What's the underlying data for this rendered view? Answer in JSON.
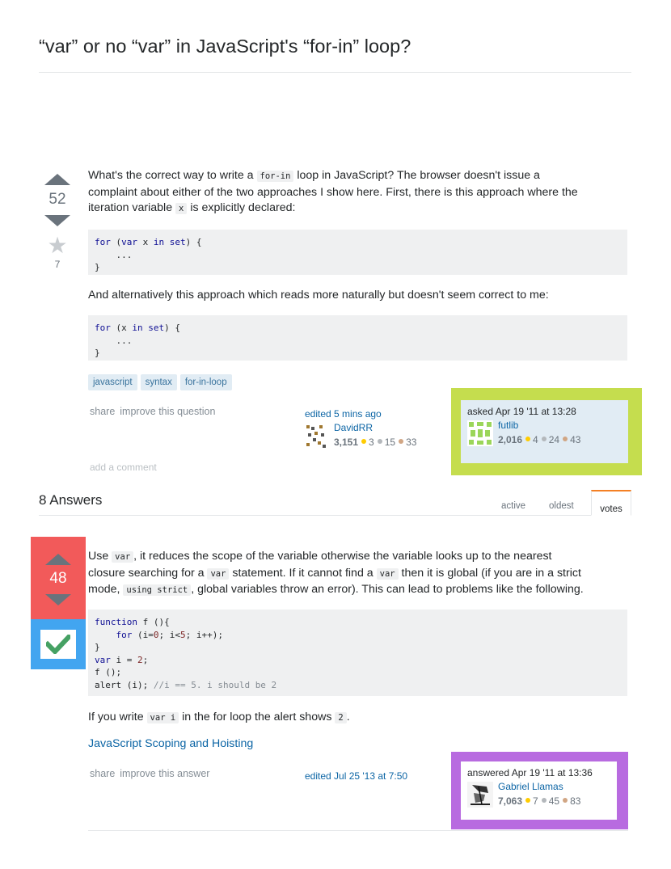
{
  "question": {
    "title": "“var” or no “var” in JavaScript's “for-in” loop?",
    "votes": "52",
    "favorites": "7",
    "p1_a": "What's the correct way to write a ",
    "p1_code": "for-in",
    "p1_b": " loop in JavaScript? The browser doesn't issue a",
    "p1_line2": "complaint about either of the two approaches I show here. First, there is this approach where the",
    "p1_line3a": "iteration variable ",
    "p1_line3code": "x",
    "p1_line3b": " is explicitly declared:",
    "code1": [
      "for (var x in set) {",
      "    ...",
      "}"
    ],
    "p2": "And alternatively this approach which reads more naturally but doesn't seem correct to me:",
    "code2": [
      "for (x in set) {",
      "    ...",
      "}"
    ],
    "tags": [
      "javascript",
      "syntax",
      "for-in-loop"
    ],
    "menu": {
      "share": "share",
      "improve": "improve this question"
    },
    "edited": {
      "label": "edited 5 mins ago",
      "user": "DavidRR",
      "rep": "3,151",
      "gold": "3",
      "silver": "15",
      "bronze": "33"
    },
    "asked": {
      "label": "asked Apr 19 '11 at 13:28",
      "user": "futlib",
      "rep": "2,016",
      "gold": "4",
      "silver": "24",
      "bronze": "43"
    },
    "add_comment": "add a comment"
  },
  "answers_header": {
    "count_label": "8 Answers",
    "tabs": [
      "active",
      "oldest",
      "votes"
    ]
  },
  "answer": {
    "votes": "48",
    "l1a": "Use ",
    "l1code": "var",
    "l1b": ", it reduces the scope of the variable otherwise the variable looks up to the nearest",
    "l2a": "closure searching for a ",
    "l2code": "var",
    "l2b": " statement. If it cannot find a ",
    "l2code2": "var",
    "l2c": " then it is global (if you are in a strict",
    "l3a": "mode, ",
    "l3code": "using strict",
    "l3b": ", global variables throw an error). This can lead to problems like the following.",
    "code": {
      "l1_kw": "function",
      "l1_rest": " f (){",
      "l2_indent": "    ",
      "l2_kw": "for",
      "l2_a": " (i=",
      "l2_n0": "0",
      "l2_b": "; i<",
      "l2_n5": "5",
      "l2_c": "; i++);",
      "l3": "}",
      "l4_kw": "var",
      "l4_a": " i = ",
      "l4_n": "2",
      "l4_b": ";",
      "l5": "f ();",
      "l6_a": "alert (i); ",
      "l6_com": "//i == 5. i should be 2"
    },
    "p2a": "If you write ",
    "p2code": "var i",
    "p2b": " in the for loop the alert shows ",
    "p2code2": "2",
    "p2c": ".",
    "link": "JavaScript Scoping and Hoisting",
    "menu": {
      "share": "share",
      "improve": "improve this answer"
    },
    "edited": {
      "label": "edited Jul 25 '13 at 7:50"
    },
    "answered": {
      "label": "answered Apr 19 '11 at 13:36",
      "user": "Gabriel Llamas",
      "rep": "7,063",
      "gold": "7",
      "silver": "45",
      "bronze": "83"
    }
  },
  "colors": {
    "highlight_green": "#c5dd4e",
    "highlight_red": "#f25a5a",
    "highlight_blue": "#42a5f0",
    "highlight_purple": "#b86be0",
    "accept_green": "#45a163",
    "gold": "#ffcc01",
    "silver": "#b4b8bc",
    "bronze": "#d1a684"
  }
}
